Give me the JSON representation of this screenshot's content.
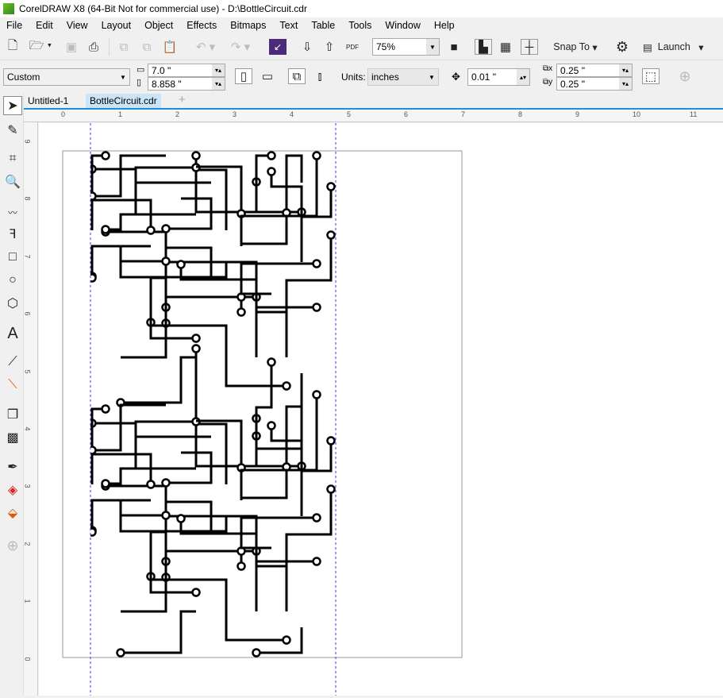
{
  "window": {
    "title": "CorelDRAW X8 (64-Bit Not for commercial use) - D:\\BottleCircuit.cdr"
  },
  "menu": [
    "File",
    "Edit",
    "View",
    "Layout",
    "Object",
    "Effects",
    "Bitmaps",
    "Text",
    "Table",
    "Tools",
    "Window",
    "Help"
  ],
  "toolbar": {
    "zoom": "75%",
    "snap_to": "Snap To",
    "launch": "Launch",
    "pdf": "PDF"
  },
  "propbar": {
    "page_size": "Custom",
    "width": "7.0 \"",
    "height": "8.858 \"",
    "units_label": "Units:",
    "units": "inches",
    "nudge": "0.01 \"",
    "dup_x": "0.25 \"",
    "dup_y": "0.25 \""
  },
  "tabs": [
    {
      "label": "Untitled-1",
      "active": false
    },
    {
      "label": "BottleCircuit.cdr",
      "active": true
    }
  ],
  "hruler": [
    "0",
    "1",
    "2",
    "3",
    "4",
    "5",
    "6",
    "7",
    "8",
    "9",
    "10",
    "11"
  ],
  "vruler": [
    "9",
    "8",
    "7",
    "6",
    "5",
    "4",
    "3",
    "2",
    "1",
    "0"
  ],
  "colors": {
    "guide": "#3a3aff",
    "accent": "#1e90d8",
    "active_tab": "#cce4f7"
  }
}
